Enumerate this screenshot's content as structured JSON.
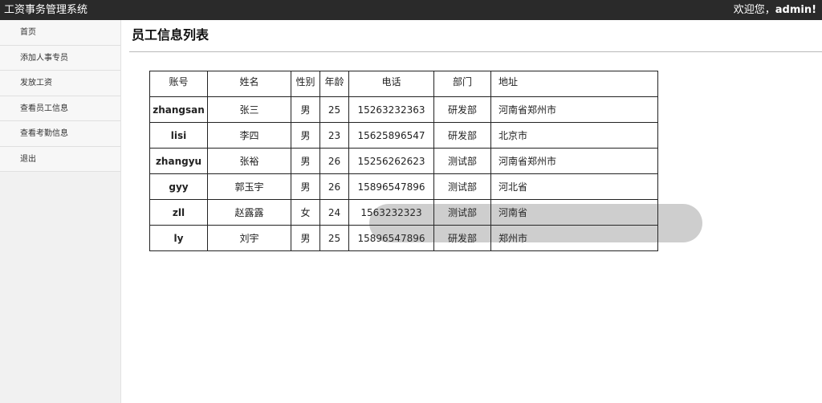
{
  "header": {
    "app_title": "工资事务管理系统",
    "welcome_prefix": "欢迎您，",
    "username": "admin!"
  },
  "sidebar": {
    "items": [
      {
        "label": "首页"
      },
      {
        "label": "添加人事专员"
      },
      {
        "label": "发放工资"
      },
      {
        "label": "查看员工信息"
      },
      {
        "label": "查看考勤信息"
      },
      {
        "label": "退出"
      }
    ]
  },
  "main": {
    "title": "员工信息列表",
    "table": {
      "headers": [
        "账号",
        "姓名",
        "性别",
        "年龄",
        "电话",
        "部门",
        "地址"
      ],
      "rows": [
        [
          "zhangsan",
          "张三",
          "男",
          "25",
          "15263232363",
          "研发部",
          "河南省郑州市"
        ],
        [
          "lisi",
          "李四",
          "男",
          "23",
          "15625896547",
          "研发部",
          "北京市"
        ],
        [
          "zhangyu",
          "张裕",
          "男",
          "26",
          "15256262623",
          "测试部",
          "河南省郑州市"
        ],
        [
          "gyy",
          "郭玉宇",
          "男",
          "26",
          "15896547896",
          "测试部",
          "河北省"
        ],
        [
          "zll",
          "赵露露",
          "女",
          "24",
          "1563232323",
          "测试部",
          "河南省"
        ],
        [
          "ly",
          "刘宇",
          "男",
          "25",
          "15896547896",
          "研发部",
          "郑州市"
        ]
      ]
    }
  },
  "colors": {
    "topbar": "#2a2a2a",
    "sidebar": "#f1f1f1"
  }
}
